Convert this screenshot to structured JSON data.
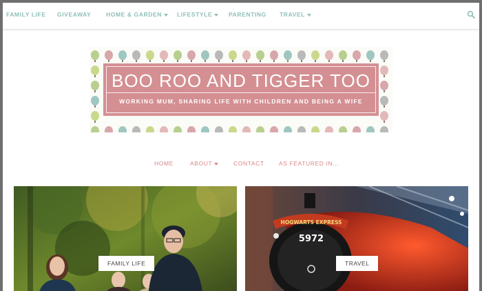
{
  "top_nav": {
    "items": [
      {
        "label": "FAMILY LIFE",
        "dropdown": false
      },
      {
        "label": "GIVEAWAY",
        "dropdown": false
      },
      {
        "label": "HOME & GARDEN",
        "dropdown": true
      },
      {
        "label": "LIFESTYLE",
        "dropdown": true
      },
      {
        "label": "PARENTING",
        "dropdown": false
      },
      {
        "label": "TRAVEL",
        "dropdown": true
      }
    ],
    "search_icon": "search-icon",
    "color": "#8fbfb8"
  },
  "banner": {
    "title": "BOO ROO AND TIGGER TOO",
    "tagline": "WORKING MUM, SHARING LIFE WITH CHILDREN AND BEING A WIFE",
    "box_color": "#d48f92"
  },
  "secondary_nav": {
    "items": [
      {
        "label": "HOME",
        "dropdown": false
      },
      {
        "label": "ABOUT",
        "dropdown": true
      },
      {
        "label": "CONTACT",
        "dropdown": false
      },
      {
        "label": "AS FEATURED IN...",
        "dropdown": false
      }
    ],
    "color": "#d9878a"
  },
  "posts": [
    {
      "category": "FAMILY LIFE"
    },
    {
      "category": "TRAVEL",
      "locomotive_number": "5972",
      "headboard": "HOGWARTS EXPRESS"
    }
  ]
}
